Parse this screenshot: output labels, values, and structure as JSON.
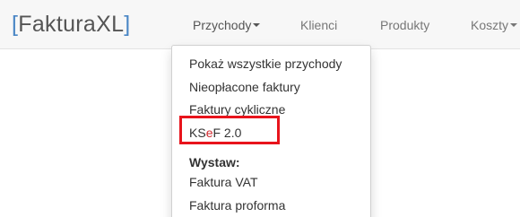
{
  "brand": {
    "open_bracket": "[",
    "name": "FakturaXL",
    "close_bracket": "]"
  },
  "nav": {
    "items": [
      {
        "label": "Przychody",
        "has_caret": true,
        "active": true
      },
      {
        "label": "Klienci"
      },
      {
        "label": "Produkty"
      },
      {
        "label": "Koszty",
        "has_caret": true
      }
    ]
  },
  "dropdown": {
    "items": [
      {
        "label": "Pokaż wszystkie przychody"
      },
      {
        "label": "Nieopłacone faktury"
      },
      {
        "label": "Faktury cykliczne"
      }
    ],
    "ksef": {
      "part1": "KS",
      "part2": "e",
      "part3": "F 2.0"
    },
    "section_header": "Wystaw:",
    "issue_items": [
      {
        "label": "Faktura VAT"
      },
      {
        "label": "Faktura proforma"
      }
    ]
  },
  "colors": {
    "brand_bracket": "#4a86c5",
    "highlight_border": "#e8141c",
    "ksef_accent": "#d0262b"
  }
}
